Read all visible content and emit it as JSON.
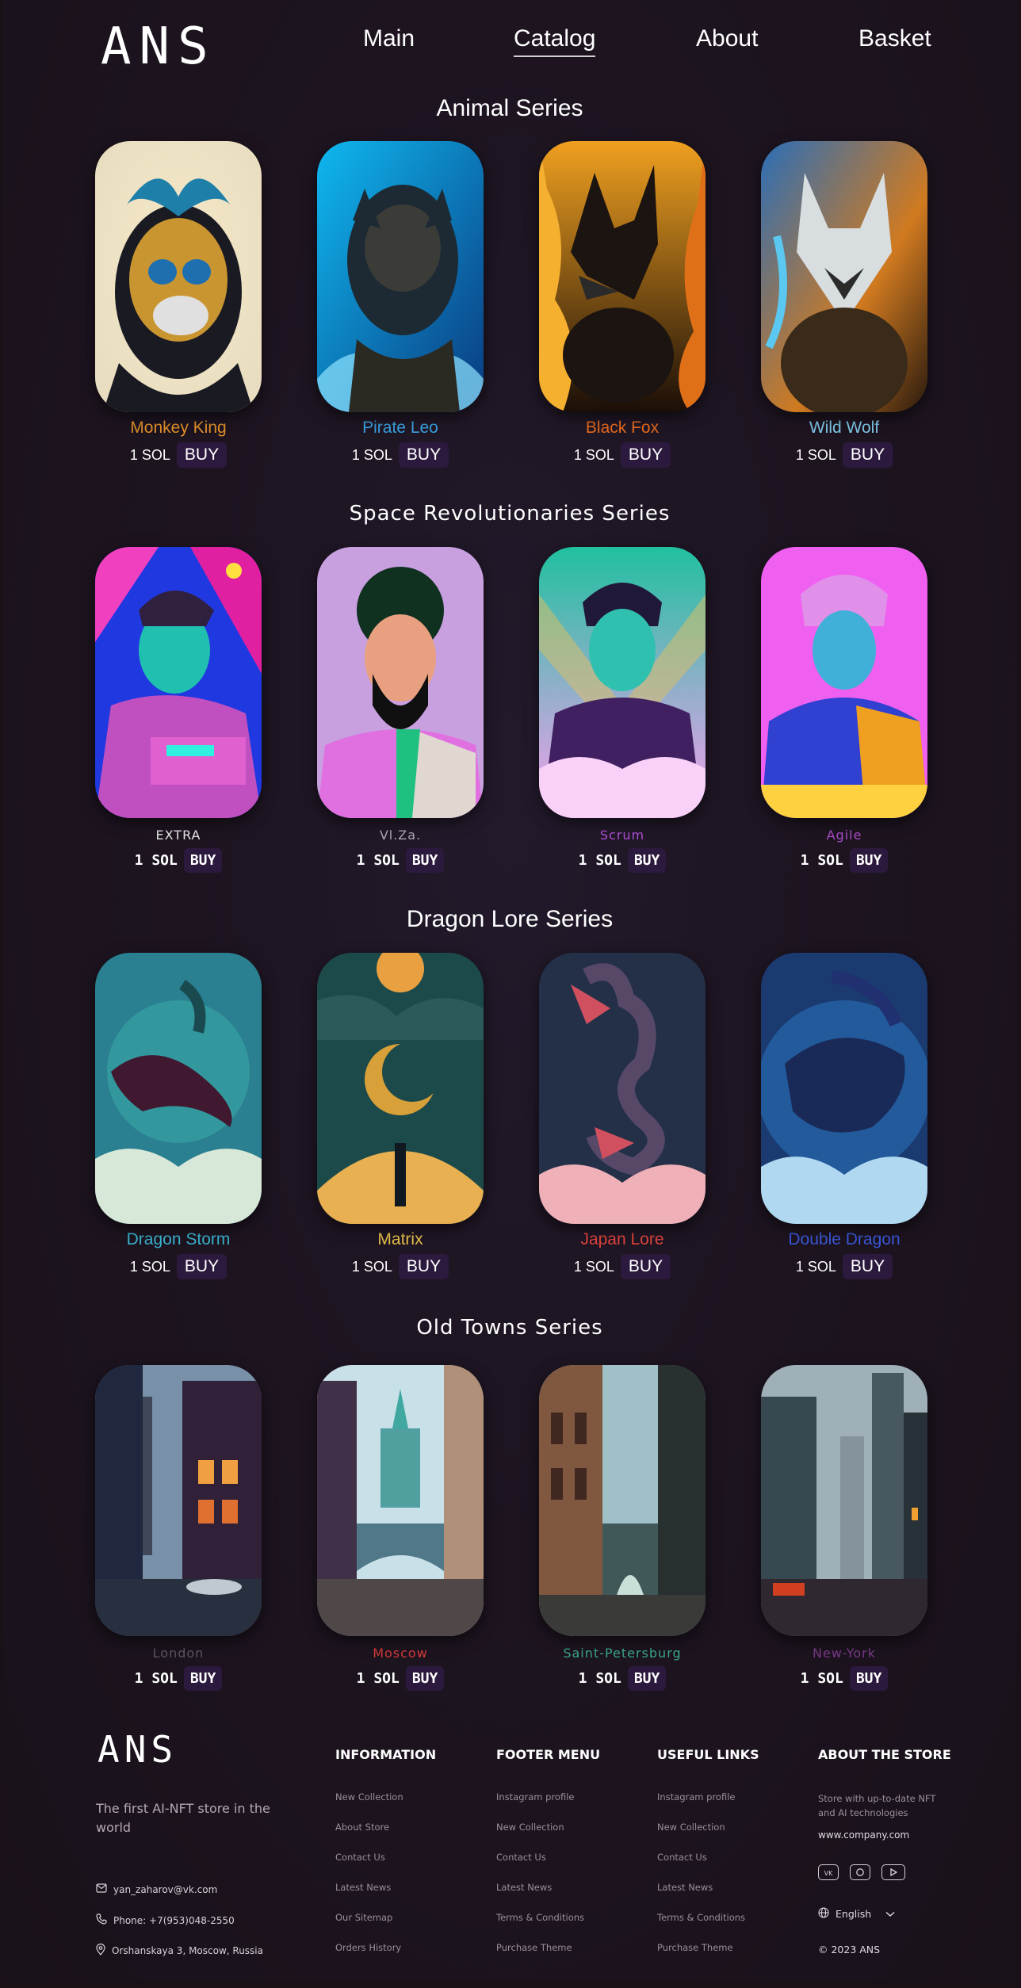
{
  "brand": "ANS",
  "nav": [
    {
      "label": "Main"
    },
    {
      "label": "Catalog"
    },
    {
      "label": "About"
    },
    {
      "label": "Basket"
    }
  ],
  "series": [
    {
      "title": "Animal Series",
      "items": [
        {
          "name": "Monkey King",
          "price": "1 SOL",
          "buy": "BUY",
          "name_color": "#e0902a"
        },
        {
          "name": "Pirate Leo",
          "price": "1 SOL",
          "buy": "BUY",
          "name_color": "#3aa0e0"
        },
        {
          "name": "Black Fox",
          "price": "1 SOL",
          "buy": "BUY",
          "name_color": "#e86a1c"
        },
        {
          "name": "Wild Wolf",
          "price": "1 SOL",
          "buy": "BUY",
          "name_color": "#7ec8e8"
        }
      ]
    },
    {
      "title": "Space Revolutionaries Series",
      "items": [
        {
          "name": "EXTRA",
          "price": "1 SOL",
          "buy": "BUY",
          "name_color": "#e8e8e8"
        },
        {
          "name": "Vl.Za.",
          "price": "1 SOL",
          "buy": "BUY",
          "name_color": "#b0a8b0"
        },
        {
          "name": "Scrum",
          "price": "1 SOL",
          "buy": "BUY",
          "name_color": "#b14fd8"
        },
        {
          "name": "Agile",
          "price": "1 SOL",
          "buy": "BUY",
          "name_color": "#a84cc8"
        }
      ]
    },
    {
      "title": "Dragon Lore Series",
      "items": [
        {
          "name": "Dragon Storm",
          "price": "1 SOL",
          "buy": "BUY",
          "name_color": "#3ab4d0"
        },
        {
          "name": "Matrix",
          "price": "1 SOL",
          "buy": "BUY",
          "name_color": "#e8c04a"
        },
        {
          "name": "Japan Lore",
          "price": "1 SOL",
          "buy": "BUY",
          "name_color": "#e0443c"
        },
        {
          "name": "Double Dragon",
          "price": "1 SOL",
          "buy": "BUY",
          "name_color": "#3a58d8"
        }
      ]
    },
    {
      "title": "Old Towns Series",
      "items": [
        {
          "name": "London",
          "price": "1 SOL",
          "buy": "BUY",
          "name_color": "#5c5664"
        },
        {
          "name": "Moscow",
          "price": "1 SOL",
          "buy": "BUY",
          "name_color": "#d83a3a"
        },
        {
          "name": "Saint-Petersburg",
          "price": "1 SOL",
          "buy": "BUY",
          "name_color": "#3aa88a"
        },
        {
          "name": "New-York",
          "price": "1 SOL",
          "buy": "BUY",
          "name_color": "#7a3a88"
        }
      ]
    }
  ],
  "footer": {
    "brand": "ANS",
    "tagline": "The first AI-NFT store in the world",
    "email": "yan_zaharov@vk.com",
    "phone": "Phone: +7(953)048-2550",
    "address": "Orshanskaya 3, Moscow, Russia",
    "columns": [
      {
        "title": "INFORMATION",
        "links": [
          "New Collection",
          "About Store",
          "Contact Us",
          "Latest News",
          "Our Sitemap",
          "Orders History"
        ]
      },
      {
        "title": "FOOTER MENU",
        "links": [
          "Instagram profile",
          "New Collection",
          "Contact Us",
          "Latest News",
          "Terms & Conditions",
          "Purchase Theme"
        ]
      },
      {
        "title": "USEFUL LINKS",
        "links": [
          "Instagram profile",
          "New Collection",
          "Contact Us",
          "Latest News",
          "Terms & Conditions",
          "Purchase Theme"
        ]
      }
    ],
    "about_title": "ABOUT THE STORE",
    "about_text": "Store with up-to-date NFT and AI technologies",
    "website": "www.company.com",
    "social_icons": [
      "vk-icon",
      "instagram-icon",
      "youtube-icon"
    ],
    "language": "English",
    "copyright": "© 2023 ANS"
  }
}
